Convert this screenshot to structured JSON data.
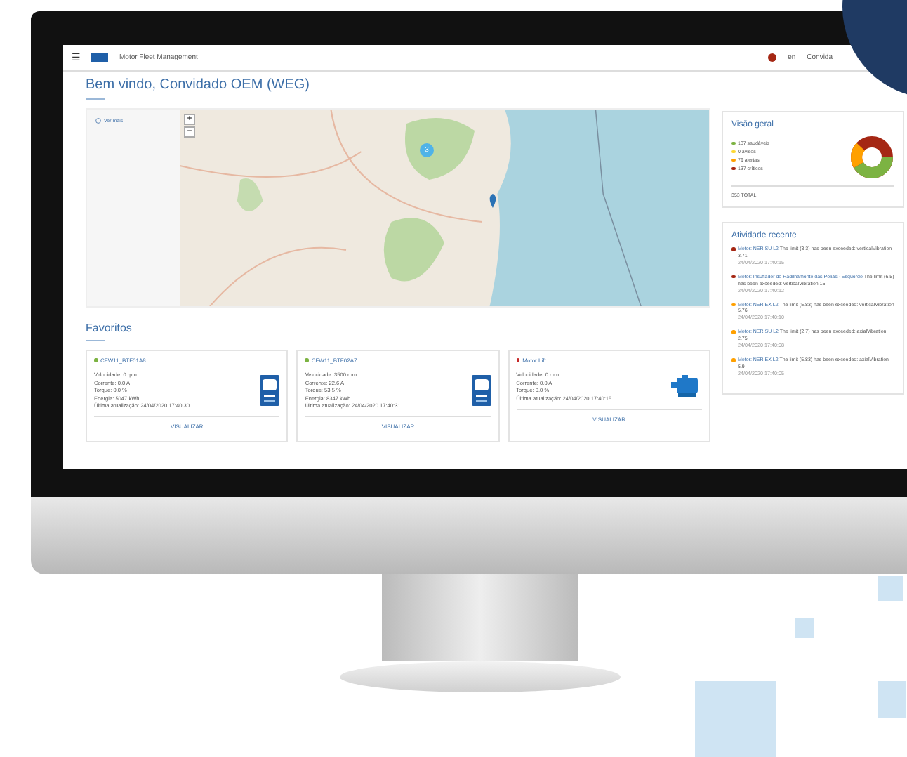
{
  "header": {
    "menu": "☰",
    "title": "Motor Fleet Management",
    "language": "en",
    "user": "Convida"
  },
  "welcome": "Bem vindo, Convidado OEM (WEG)",
  "map": {
    "link": "Ver mais",
    "zoom_in": "+",
    "zoom_out": "−",
    "cluster": "3"
  },
  "favorites": {
    "title": "Favoritos",
    "cards": [
      {
        "name": "CFW11_BTF01A8",
        "color": "#7cb342",
        "kind": "drive",
        "action": "VISUALIZAR",
        "lines": [
          "Velocidade: 0 rpm",
          "Corrente: 0.0 A",
          "Torque: 0.0 %",
          "Energia: 5047 kWh",
          "Última atualização: 24/04/2020 17:40:30"
        ]
      },
      {
        "name": "CFW11_BTF02A7",
        "color": "#7cb342",
        "kind": "drive",
        "action": "VISUALIZAR",
        "lines": [
          "Velocidade: 3500 rpm",
          "Corrente: 22.6 A",
          "Torque: 53.5 %",
          "Energia: 8347 kWh",
          "Última atualização: 24/04/2020 17:40:31"
        ]
      },
      {
        "name": "Motor Lift",
        "color": "#c62828",
        "kind": "motor",
        "action": "VISUALIZAR",
        "lines": [
          "Velocidade: 0 rpm",
          "Corrente: 0.0 A",
          "Torque: 0.0 %",
          "Última atualização: 24/04/2020 17:40:15"
        ]
      }
    ]
  },
  "overview": {
    "title": "Visão geral",
    "total": "353 TOTAL",
    "items": [
      {
        "label": "137 saudáveis",
        "color": "#7cb342"
      },
      {
        "label": "0 avisos",
        "color": "#fdd835"
      },
      {
        "label": "79 alertas",
        "color": "#ffa000"
      },
      {
        "label": "137 críticos",
        "color": "#a52714"
      }
    ]
  },
  "activity": {
    "title": "Atividade recente",
    "items": [
      {
        "color": "#a52714",
        "motor": "Motor: NER SU L2",
        "message": "The limit (3.3) has been exceeded: verticalVibration 3.71",
        "time": "24/04/2020 17:40:15"
      },
      {
        "color": "#a52714",
        "motor": "Motor: Insuflador do Radilhamento das Polias - Esquerdo",
        "message": "The limit (6.5) has been exceeded: verticalVibration 15",
        "time": "24/04/2020 17:40:12"
      },
      {
        "color": "#ffa000",
        "motor": "Motor: NER EX L2",
        "message": "The limit (5.83) has been exceeded: verticalVibration 5.76",
        "time": "24/04/2020 17:40:10"
      },
      {
        "color": "#ffa000",
        "motor": "Motor: NER SU L2",
        "message": "The limit (2.7) has been exceeded: axialVibration 2.75",
        "time": "24/04/2020 17:40:08"
      },
      {
        "color": "#ffa000",
        "motor": "Motor: NER EX L2",
        "message": "The limit (5.83) has been exceeded: axialVibration 5.9",
        "time": "24/04/2020 17:40:05"
      }
    ]
  }
}
